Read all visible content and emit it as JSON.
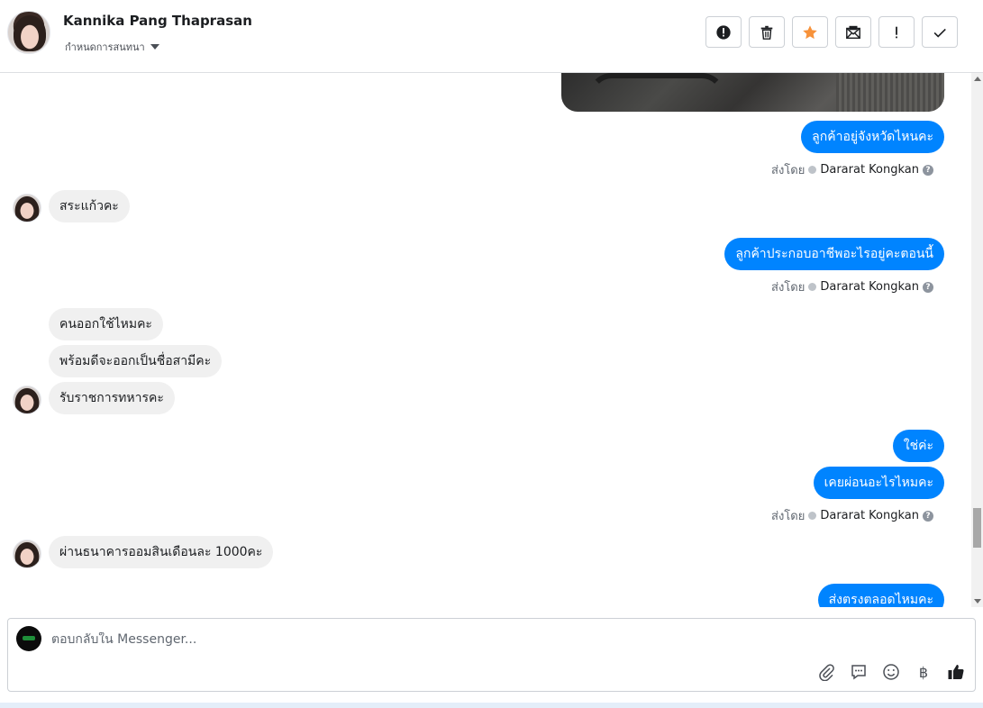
{
  "header": {
    "contact_name": "Kannika Pang Thaprasan",
    "assign_label": "กำหนดการสนทนา",
    "toolbar": [
      {
        "name": "report-spam-button",
        "icon": "alert-circle-icon"
      },
      {
        "name": "delete-button",
        "icon": "trash-icon"
      },
      {
        "name": "star-button",
        "icon": "star-icon",
        "color": "#f7923a"
      },
      {
        "name": "mark-unread-button",
        "icon": "envelope-icon"
      },
      {
        "name": "follow-up-button",
        "icon": "exclamation-icon"
      },
      {
        "name": "mark-done-button",
        "icon": "check-icon"
      }
    ]
  },
  "messages": {
    "m1": "ลูกค้าอยู่จังหวัดไหนคะ",
    "m2": "สระแก้วคะ",
    "m3": "ลูกค้าประกอบอาชีพอะไรอยู่คะตอนนี้",
    "m4": "คนออกใช้ไหมคะ",
    "m5": "พร้อมดีจะออกเป็นชื่อสามีคะ",
    "m6": "รับราชการทหารคะ",
    "m7": "ใช่ค่ะ",
    "m8": "เคยผ่อนอะไรไหมคะ",
    "m9": "ผ่านธนาคารออมสินเดือนละ 1000คะ",
    "m10": "ส่งตรงตลอดไหมคะ"
  },
  "sent_by": {
    "prefix": "ส่งโดย",
    "agent": "Dararat Kongkan",
    "help": "?"
  },
  "composer": {
    "placeholder": "ตอบกลับใน Messenger...",
    "currency_symbol": "฿"
  },
  "colors": {
    "outgoing_bubble": "#0084ff",
    "incoming_bubble": "#f0f0f0",
    "star_accent": "#f7923a"
  }
}
